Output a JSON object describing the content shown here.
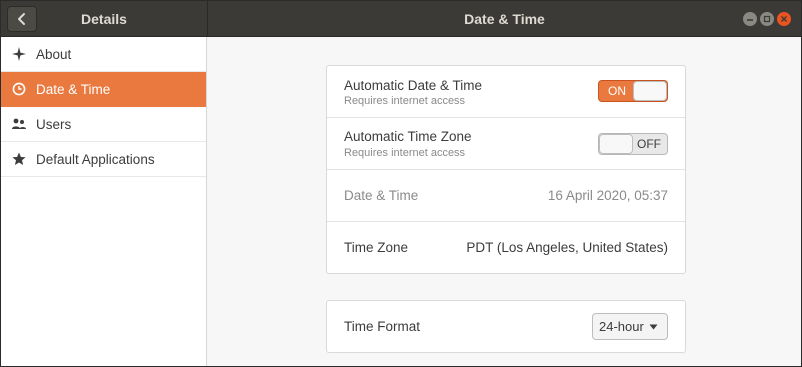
{
  "header": {
    "sidebar_title": "Details",
    "window_title": "Date & Time",
    "back_icon": "chevron-left-icon"
  },
  "sidebar": {
    "items": [
      {
        "label": "About",
        "icon": "sparkle-icon",
        "active": false
      },
      {
        "label": "Date & Time",
        "icon": "clock-icon",
        "active": true
      },
      {
        "label": "Users",
        "icon": "users-icon",
        "active": false
      },
      {
        "label": "Default Applications",
        "icon": "star-icon",
        "active": false
      }
    ]
  },
  "main": {
    "auto_datetime": {
      "label": "Automatic Date & Time",
      "sublabel": "Requires internet access",
      "switch": "ON"
    },
    "auto_timezone": {
      "label": "Automatic Time Zone",
      "sublabel": "Requires internet access",
      "switch": "OFF"
    },
    "datetime": {
      "label": "Date & Time",
      "value": "16 April 2020, 05:37"
    },
    "timezone": {
      "label": "Time Zone",
      "value": "PDT (Los Angeles, United States)"
    },
    "time_format": {
      "label": "Time Format",
      "value": "24-hour"
    }
  },
  "colors": {
    "accent": "#e9793e",
    "headerbar": "#3b3a36",
    "close_button": "#e95420"
  }
}
